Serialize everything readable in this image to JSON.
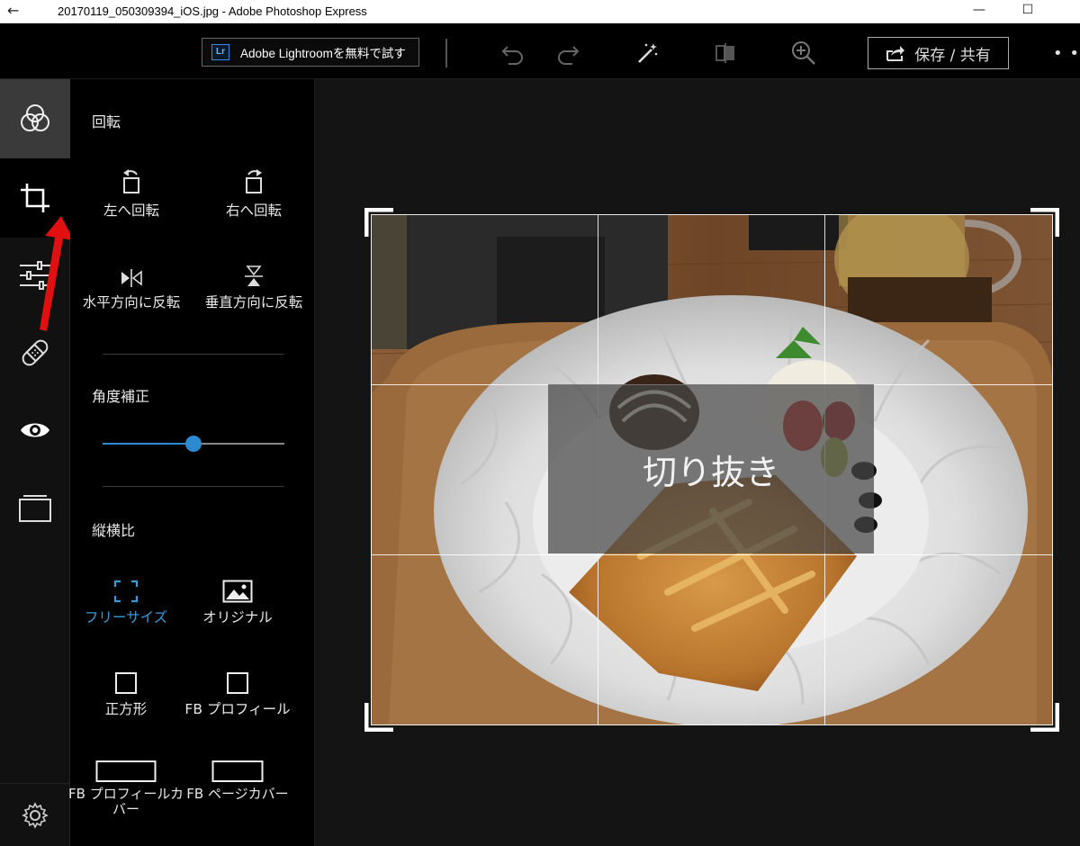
{
  "window": {
    "title": "20170119_050309394_iOS.jpg - Adobe Photoshop Express",
    "back_glyph": "←",
    "minimize_glyph": "—",
    "maximize_glyph": "☐"
  },
  "toolbar": {
    "lightroom_badge": "Lr",
    "lightroom_label": "Adobe Lightroomを無料で試す",
    "save_share_label": "保存 / 共有",
    "more_glyph": "• •"
  },
  "panel": {
    "rotate_title": "回転",
    "rotate_left": "左へ回転",
    "rotate_right": "右へ回転",
    "flip_horizontal": "水平方向に反転",
    "flip_vertical": "垂直方向に反転",
    "straighten_title": "角度補正",
    "straighten_value": 0.5,
    "aspect_title": "縦横比",
    "aspect_free": "フリーサイズ",
    "aspect_original": "オリジナル",
    "aspect_square": "正方形",
    "aspect_fb_profile": "FB プロフィール",
    "aspect_fb_cover_line1": "FB プロフィールカ",
    "aspect_fb_cover_line2": "バー",
    "aspect_fb_page_cover": "FB ページカバー"
  },
  "canvas": {
    "crop_overlay_label": "切り抜き"
  },
  "colors": {
    "accent": "#2c8bd0",
    "annotation_arrow": "#e01010"
  }
}
